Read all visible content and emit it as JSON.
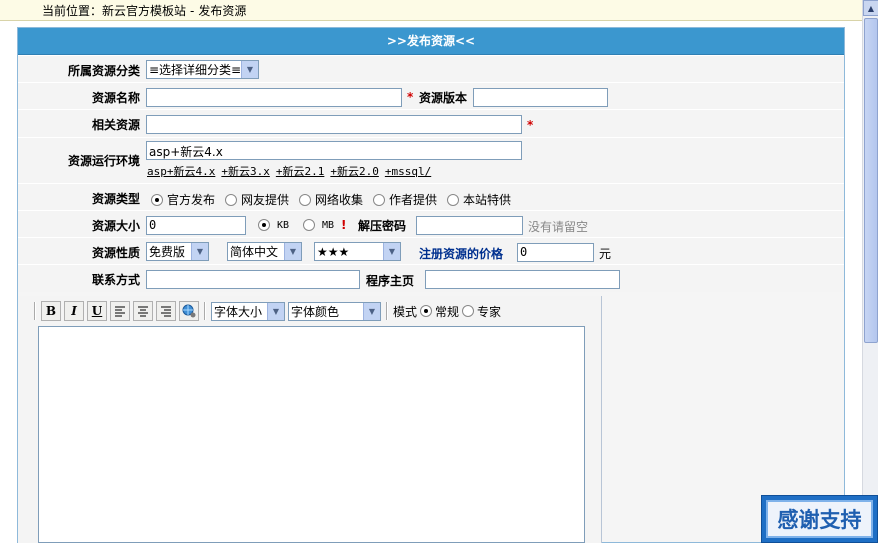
{
  "breadcrumb": {
    "prefix": "当前位置：",
    "site": "新云官方模板站",
    "separator": "-",
    "page": "发布资源"
  },
  "form": {
    "title": ">>发布资源<<",
    "category": {
      "label": "所属资源分类",
      "value": "≡选择详细分类≡"
    },
    "name": {
      "label": "资源名称",
      "value": "",
      "required_mark": "*"
    },
    "version": {
      "label": "资源版本",
      "value": ""
    },
    "related": {
      "label": "相关资源",
      "value": "",
      "required_mark": "*"
    },
    "env": {
      "label": "资源运行环境",
      "value": "asp+新云4.x",
      "presets": [
        "asp+新云4.x",
        "+新云3.x",
        "+新云2.1",
        "+新云2.0",
        "+mssql/"
      ]
    },
    "type": {
      "label": "资源类型",
      "options": [
        {
          "label": "官方发布",
          "checked": true
        },
        {
          "label": "网友提供",
          "checked": false
        },
        {
          "label": "网络收集",
          "checked": false
        },
        {
          "label": "作者提供",
          "checked": false
        },
        {
          "label": "本站特供",
          "checked": false
        }
      ]
    },
    "size": {
      "label": "资源大小",
      "value": "0",
      "unit_kb": "KB",
      "unit_mb": "MB",
      "unit_kb_checked": true,
      "required_mark": "!"
    },
    "password": {
      "label": "解压密码",
      "value": "",
      "hint": "没有请留空"
    },
    "nature": {
      "label": "资源性质",
      "license": "免费版",
      "language": "简体中文",
      "rating": "★★★",
      "price_label": "注册资源的价格",
      "price_value": "0",
      "currency": "元"
    },
    "contact": {
      "label": "联系方式",
      "value": ""
    },
    "homepage": {
      "label": "程序主页",
      "value": ""
    }
  },
  "editor": {
    "buttons": {
      "bold": "B",
      "italic": "I",
      "underline": "U"
    },
    "font_size": "字体大小",
    "font_color": "字体颜色",
    "mode_label": "模式",
    "mode_normal": "常规",
    "mode_expert": "专家",
    "mode_normal_checked": true
  },
  "thanks_button": "感谢支持"
}
